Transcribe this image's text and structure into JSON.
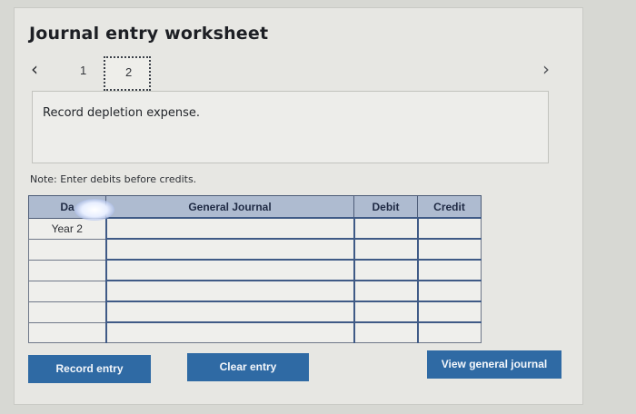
{
  "title": "Journal entry worksheet",
  "pager": {
    "prev_icon": "chevron-left-icon",
    "next_icon": "chevron-right-icon",
    "pages": [
      "1",
      "2"
    ],
    "current": "2"
  },
  "instruction": "Record depletion expense.",
  "note": "Note: Enter debits before credits.",
  "table": {
    "headers": {
      "date": "Da",
      "general_journal": "General Journal",
      "debit": "Debit",
      "credit": "Credit"
    },
    "rows": [
      {
        "date": "Year 2",
        "account": "",
        "debit": "",
        "credit": ""
      },
      {
        "date": "",
        "account": "",
        "debit": "",
        "credit": ""
      },
      {
        "date": "",
        "account": "",
        "debit": "",
        "credit": ""
      },
      {
        "date": "",
        "account": "",
        "debit": "",
        "credit": ""
      },
      {
        "date": "",
        "account": "",
        "debit": "",
        "credit": ""
      },
      {
        "date": "",
        "account": "",
        "debit": "",
        "credit": ""
      }
    ]
  },
  "buttons": {
    "record": "Record entry",
    "clear": "Clear entry",
    "view": "View general journal"
  },
  "colors": {
    "button": "#2f6aa4",
    "header": "#aebbd0",
    "panel": "#e7e7e3"
  }
}
